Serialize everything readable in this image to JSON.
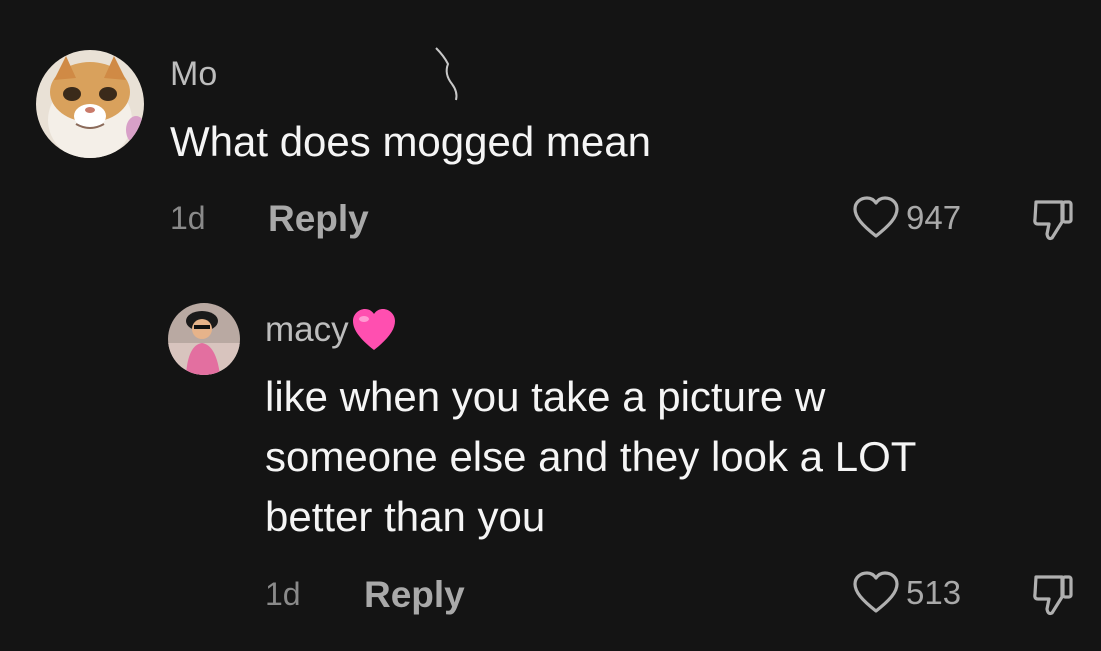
{
  "comments": [
    {
      "username": "Mo",
      "text": "What does mogged mean",
      "age": "1d",
      "reply_label": "Reply",
      "likes": "947"
    },
    {
      "username": "macy",
      "username_emoji": "pink-heart-emoji",
      "text_lines": [
        "like when you take a picture w",
        "someone else and they look a LOT",
        "better than you"
      ],
      "age": "1d",
      "reply_label": "Reply",
      "likes": "513"
    }
  ],
  "icons": {
    "like": "heart-outline-icon",
    "dislike": "thumbs-down-icon"
  },
  "colors": {
    "background": "#141414",
    "heart_emoji": "#ff4fb0"
  }
}
